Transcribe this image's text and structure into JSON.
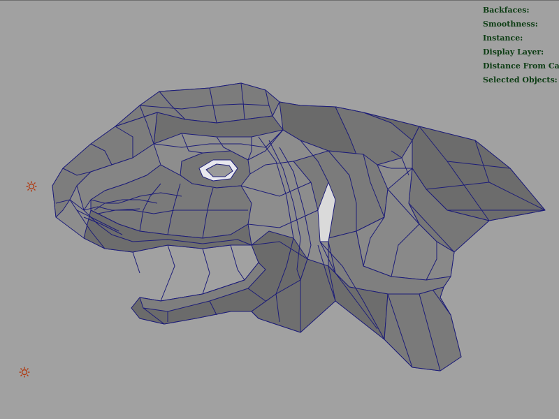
{
  "hud": {
    "lines": [
      "Backfaces:",
      "Smoothness:",
      "Instance:",
      "Display Layer:",
      "Distance From Came",
      "Selected Objects:"
    ]
  },
  "colors": {
    "background": "#a1a1a1",
    "wireframe": "#1c1c78",
    "hud_text": "#0d3d14",
    "light_icon": "#b03a12"
  },
  "icons": {
    "light_top": "directional-light-icon",
    "light_bottom": "directional-light-icon"
  }
}
